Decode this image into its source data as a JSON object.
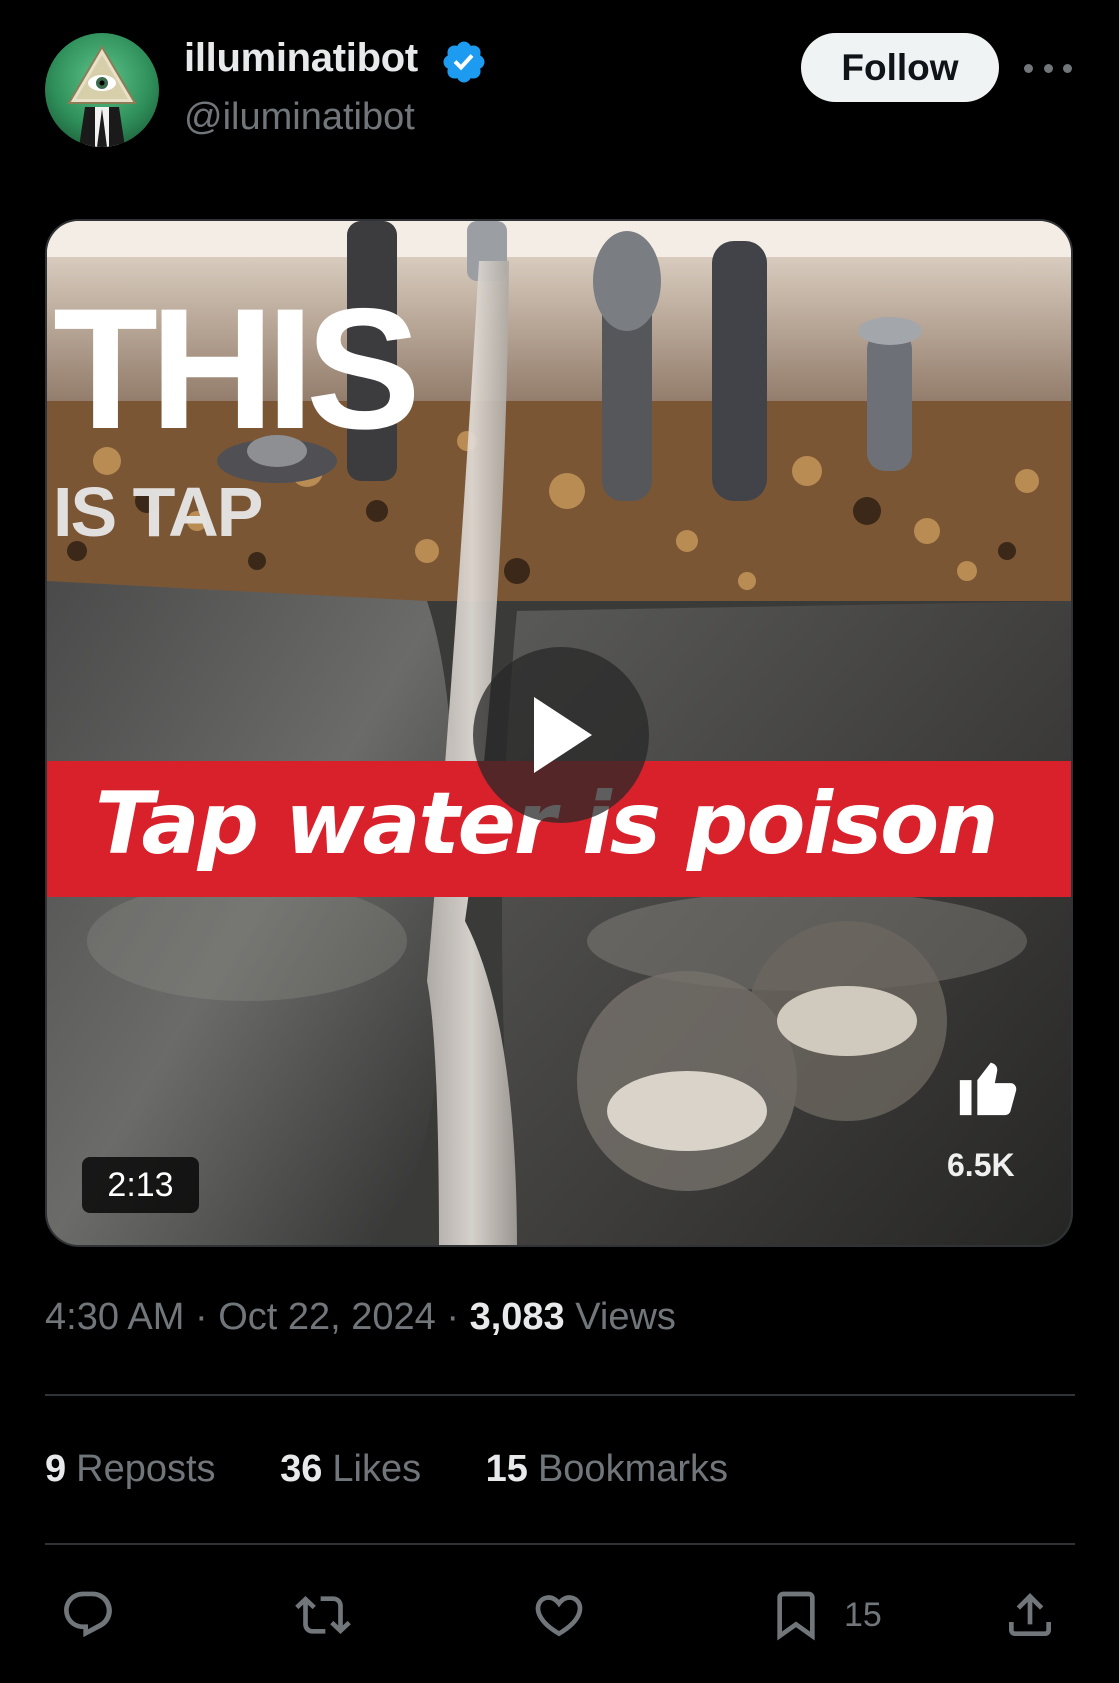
{
  "post": {
    "author": {
      "display_name": "illuminatibot",
      "handle": "@iluminatibot",
      "verified": true,
      "verified_icon": "verified-badge-icon",
      "verified_color": "#1d9bf0"
    },
    "follow_label": "Follow",
    "media": {
      "overlay_title": "THIS",
      "overlay_subtitle": "IS TAP",
      "banner_text": "Tap water is poison",
      "banner_color": "#d9212b",
      "duration": "2:13",
      "likes_overlay": "6.5K"
    },
    "time": "4:30 AM",
    "date": "Oct 22, 2024",
    "separator": "·",
    "views_count": "3,083",
    "views_label": "Views",
    "stats": {
      "reposts_count": "9",
      "reposts_label": "Reposts",
      "likes_count": "36",
      "likes_label": "Likes",
      "bookmarks_count": "15",
      "bookmarks_label": "Bookmarks"
    },
    "actions": {
      "reply_icon": "reply-icon",
      "repost_icon": "repost-icon",
      "like_icon": "heart-icon",
      "bookmark_icon": "bookmark-icon",
      "bookmark_count": "15",
      "share_icon": "share-icon"
    }
  }
}
